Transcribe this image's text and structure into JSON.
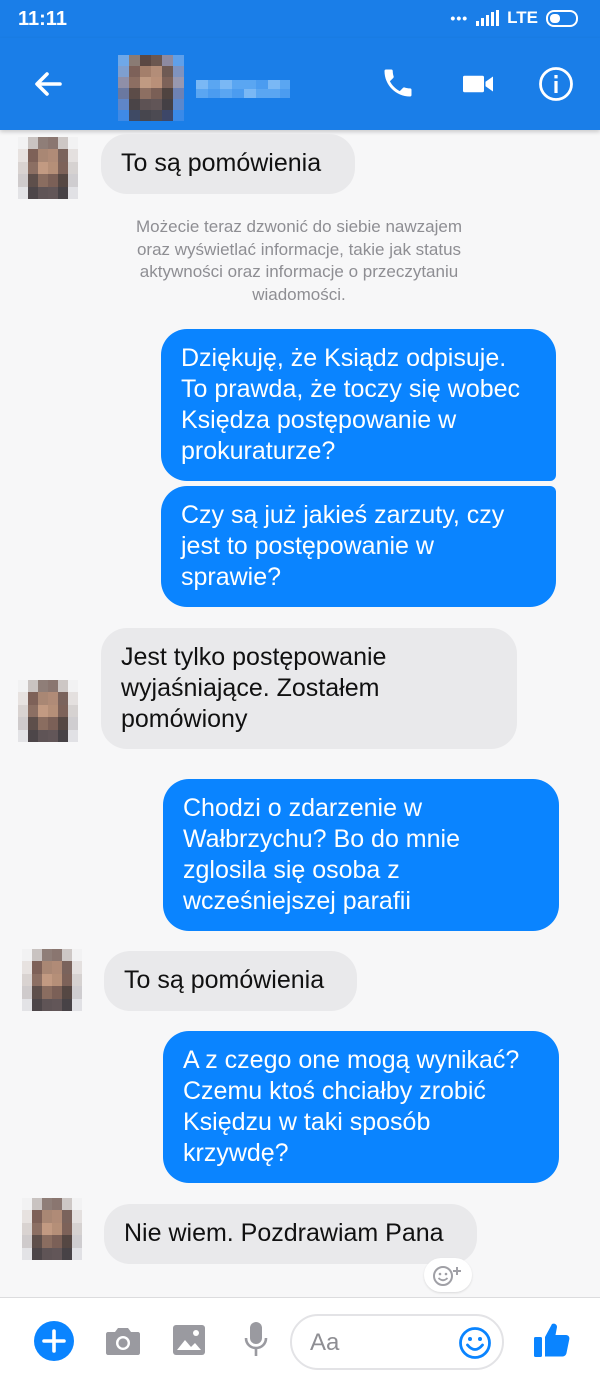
{
  "status_bar": {
    "time": "11:11",
    "network": "LTE"
  },
  "header": {
    "contact_name": "",
    "icons": [
      "back-arrow-icon",
      "phone-icon",
      "video-camera-icon",
      "info-icon"
    ]
  },
  "messages": [
    {
      "direction": "incoming",
      "text": "To są pomówienia"
    },
    {
      "direction": "system",
      "text": "Możecie teraz dzwonić do siebie nawzajem\noraz wyświetlać informacje, takie jak status\naktywności oraz informacje o przeczytaniu\nwiadomości."
    },
    {
      "direction": "outgoing",
      "text": "Dziękuję, że Ksiądz odpisuje.\nTo prawda, że toczy się wobec\nKsiędza postępowanie w\nprokuraturze?"
    },
    {
      "direction": "outgoing",
      "text": "Czy są już jakieś zarzuty, czy\njest to postępowanie w\nsprawie?"
    },
    {
      "direction": "incoming",
      "text": "Jest tylko postępowanie\nwyjaśniające. Zostałem\npomówiony"
    },
    {
      "direction": "outgoing",
      "text": "Chodzi o zdarzenie w\nWałbrzychu? Bo do mnie\nzglosila się osoba z\nwcześniejszej parafii"
    },
    {
      "direction": "incoming",
      "text": "To są pomówienia"
    },
    {
      "direction": "outgoing",
      "text": "A z czego one mogą wynikać?\nCzemu ktoś chciałby zrobić\nKsiędzu w taki sposób\nkrzywdę?"
    },
    {
      "direction": "incoming",
      "text": "Nie wiem. Pozdrawiam Pana"
    }
  ],
  "composer": {
    "placeholder": "Aa",
    "icons": [
      "plus-icon",
      "camera-icon",
      "image-icon",
      "microphone-icon",
      "emoji-icon",
      "like-icon"
    ]
  },
  "colors": {
    "header_blue": "#1a7ee8",
    "outgoing_bubble": "#0a84ff",
    "incoming_bubble": "#e9e9eb",
    "system_text": "#8e8e93"
  }
}
